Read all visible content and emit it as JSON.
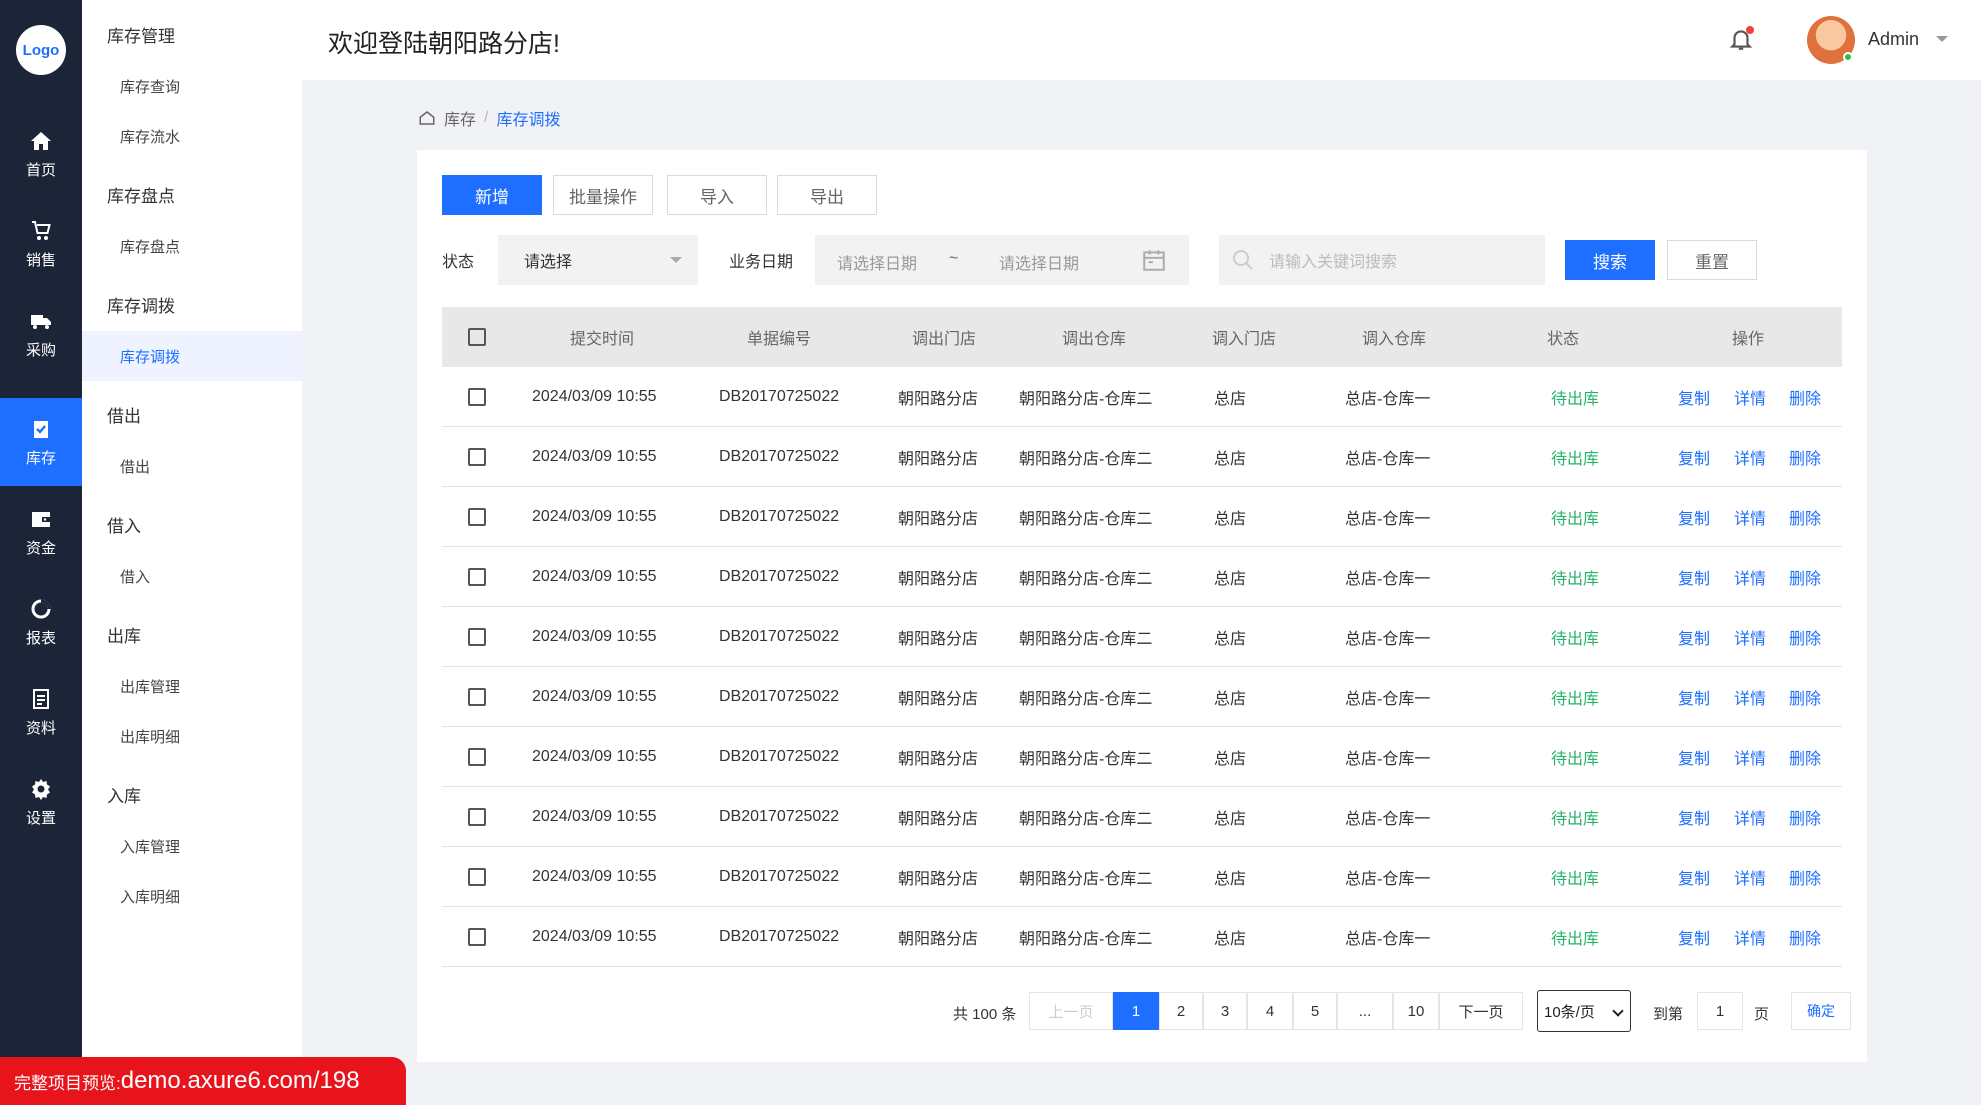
{
  "nav": {
    "logo": "Logo",
    "items": [
      {
        "label": "首页",
        "icon": "home-icon"
      },
      {
        "label": "销售",
        "icon": "cart-icon"
      },
      {
        "label": "采购",
        "icon": "truck-icon"
      },
      {
        "label": "库存",
        "icon": "clipboard-check-icon",
        "active": true
      },
      {
        "label": "资金",
        "icon": "wallet-icon"
      },
      {
        "label": "报表",
        "icon": "chart-ring-icon"
      },
      {
        "label": "资料",
        "icon": "document-icon"
      },
      {
        "label": "设置",
        "icon": "gear-icon"
      }
    ]
  },
  "submenu": {
    "groups": [
      {
        "title": "库存管理",
        "items": [
          "库存查询",
          "库存流水"
        ]
      },
      {
        "title": "库存盘点",
        "items": [
          "库存盘点"
        ]
      },
      {
        "title": "库存调拨",
        "items": [
          "库存调拨"
        ]
      },
      {
        "title": "借出",
        "items": [
          "借出"
        ]
      },
      {
        "title": "借入",
        "items": [
          "借入"
        ]
      },
      {
        "title": "出库",
        "items": [
          "出库管理",
          "出库明细"
        ]
      },
      {
        "title": "入库",
        "items": [
          "入库管理",
          "入库明细"
        ]
      }
    ],
    "active": "库存调拨"
  },
  "header": {
    "welcome": "欢迎登陆朝阳路分店!",
    "user": "Admin"
  },
  "breadcrumb": {
    "root": "库存",
    "sep": "/",
    "current": "库存调拨"
  },
  "toolbar": {
    "add": "新增",
    "batch": "批量操作",
    "import": "导入",
    "export": "导出"
  },
  "filters": {
    "status_label": "状态",
    "status_value": "请选择",
    "date_label": "业务日期",
    "date_start": "请选择日期",
    "date_tilde": "~",
    "date_end": "请选择日期",
    "search_placeholder": "请输入关键词搜索",
    "search_btn": "搜索",
    "reset_btn": "重置"
  },
  "table": {
    "columns": [
      "提交时间",
      "单据编号",
      "调出门店",
      "调出仓库",
      "调入门店",
      "调入仓库",
      "状态",
      "操作"
    ],
    "actions": [
      "复制",
      "详情",
      "删除"
    ],
    "rows": [
      {
        "time": "2024/03/09 10:55",
        "no": "DB20170725022",
        "out_store": "朝阳路分店",
        "out_wh": "朝阳路分店-仓库二",
        "in_store": "总店",
        "in_wh": "总店-仓库一",
        "status": "待出库"
      },
      {
        "time": "2024/03/09 10:55",
        "no": "DB20170725022",
        "out_store": "朝阳路分店",
        "out_wh": "朝阳路分店-仓库二",
        "in_store": "总店",
        "in_wh": "总店-仓库一",
        "status": "待出库"
      },
      {
        "time": "2024/03/09 10:55",
        "no": "DB20170725022",
        "out_store": "朝阳路分店",
        "out_wh": "朝阳路分店-仓库二",
        "in_store": "总店",
        "in_wh": "总店-仓库一",
        "status": "待出库"
      },
      {
        "time": "2024/03/09 10:55",
        "no": "DB20170725022",
        "out_store": "朝阳路分店",
        "out_wh": "朝阳路分店-仓库二",
        "in_store": "总店",
        "in_wh": "总店-仓库一",
        "status": "待出库"
      },
      {
        "time": "2024/03/09 10:55",
        "no": "DB20170725022",
        "out_store": "朝阳路分店",
        "out_wh": "朝阳路分店-仓库二",
        "in_store": "总店",
        "in_wh": "总店-仓库一",
        "status": "待出库"
      },
      {
        "time": "2024/03/09 10:55",
        "no": "DB20170725022",
        "out_store": "朝阳路分店",
        "out_wh": "朝阳路分店-仓库二",
        "in_store": "总店",
        "in_wh": "总店-仓库一",
        "status": "待出库"
      },
      {
        "time": "2024/03/09 10:55",
        "no": "DB20170725022",
        "out_store": "朝阳路分店",
        "out_wh": "朝阳路分店-仓库二",
        "in_store": "总店",
        "in_wh": "总店-仓库一",
        "status": "待出库"
      },
      {
        "time": "2024/03/09 10:55",
        "no": "DB20170725022",
        "out_store": "朝阳路分店",
        "out_wh": "朝阳路分店-仓库二",
        "in_store": "总店",
        "in_wh": "总店-仓库一",
        "status": "待出库"
      },
      {
        "time": "2024/03/09 10:55",
        "no": "DB20170725022",
        "out_store": "朝阳路分店",
        "out_wh": "朝阳路分店-仓库二",
        "in_store": "总店",
        "in_wh": "总店-仓库一",
        "status": "待出库"
      },
      {
        "time": "2024/03/09 10:55",
        "no": "DB20170725022",
        "out_store": "朝阳路分店",
        "out_wh": "朝阳路分店-仓库二",
        "in_store": "总店",
        "in_wh": "总店-仓库一",
        "status": "待出库"
      }
    ]
  },
  "pagination": {
    "total": "共 100 条",
    "prev": "上一页",
    "pages": [
      "1",
      "2",
      "3",
      "4",
      "5",
      "...",
      "10"
    ],
    "next": "下一页",
    "page_size": "10条/页",
    "goto_label": "到第",
    "goto_value": "1",
    "page_unit": "页",
    "confirm": "确定"
  },
  "watermark": {
    "prefix": "完整项目预览:",
    "url": "demo.axure6.com/198"
  },
  "colors": {
    "accent": "#1e6fff",
    "nav_bg": "#1c2538",
    "status_green": "#27b36b",
    "watermark_red": "#e8141c"
  }
}
